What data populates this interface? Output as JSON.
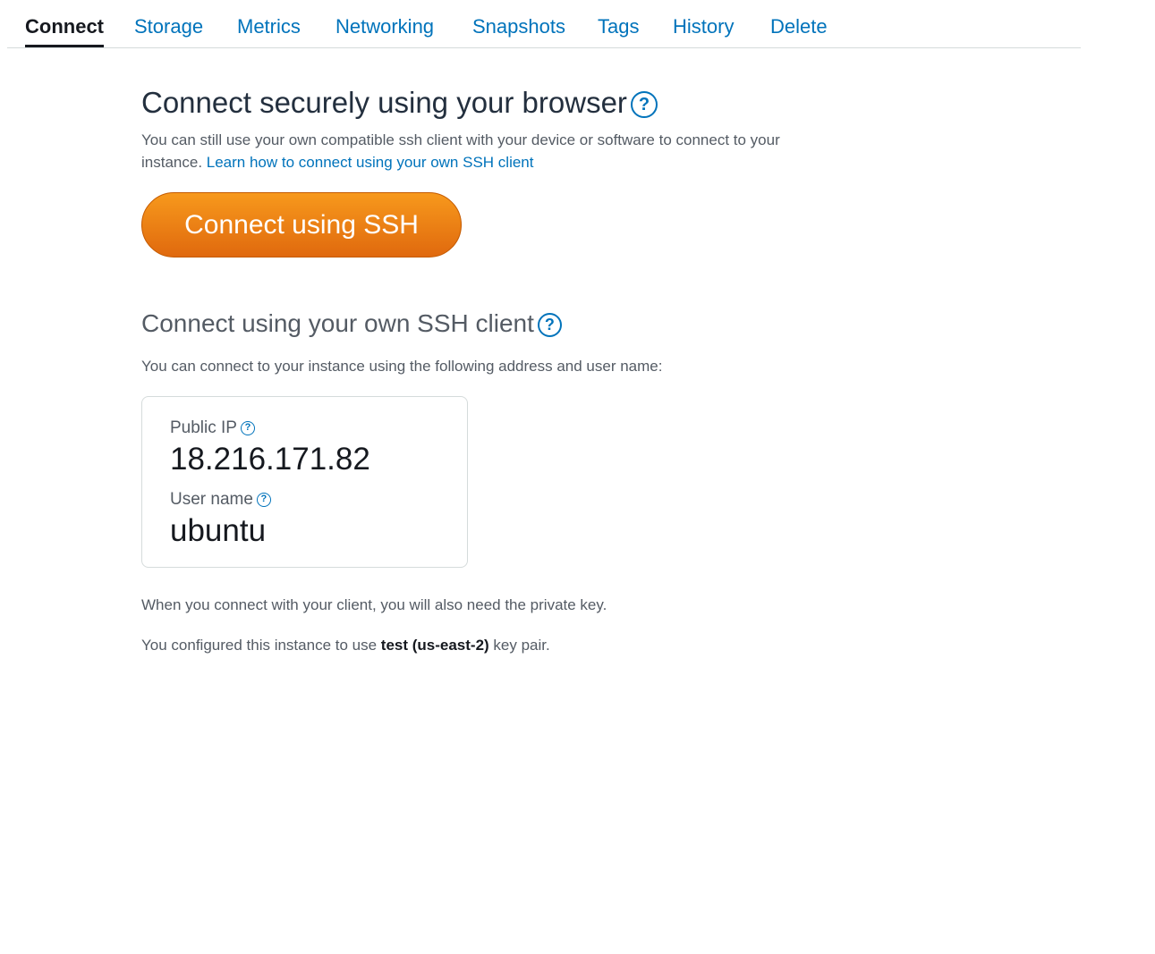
{
  "tabs": [
    {
      "label": "Connect",
      "active": true
    },
    {
      "label": "Storage"
    },
    {
      "label": "Metrics"
    },
    {
      "label": "Networking"
    },
    {
      "label": "Snapshots"
    },
    {
      "label": "Tags"
    },
    {
      "label": "History"
    },
    {
      "label": "Delete"
    }
  ],
  "browser_section": {
    "heading": "Connect securely using your browser",
    "help_glyph": "?",
    "description": "You can still use your own compatible ssh client with your device or software to connect to your instance. ",
    "link_text": "Learn how to connect using your own SSH client",
    "button_label": "Connect using SSH"
  },
  "client_section": {
    "heading": "Connect using your own SSH client",
    "help_glyph": "?",
    "description": "You can connect to your instance using the following address and user name:"
  },
  "details": {
    "ip_label": "Public IP",
    "ip_value": "18.216.171.82",
    "user_label": "User name",
    "user_value": "ubuntu",
    "help_glyph": "?"
  },
  "key_info": {
    "private_key_note": "When you connect with your client, you will also need the private key.",
    "configured_prefix": "You configured this instance to use ",
    "key_name": "test (us-east-2)",
    "configured_suffix": " key pair."
  },
  "colors": {
    "link": "#0073bb",
    "button_top": "#f7991c",
    "button_bottom": "#e0690e"
  }
}
